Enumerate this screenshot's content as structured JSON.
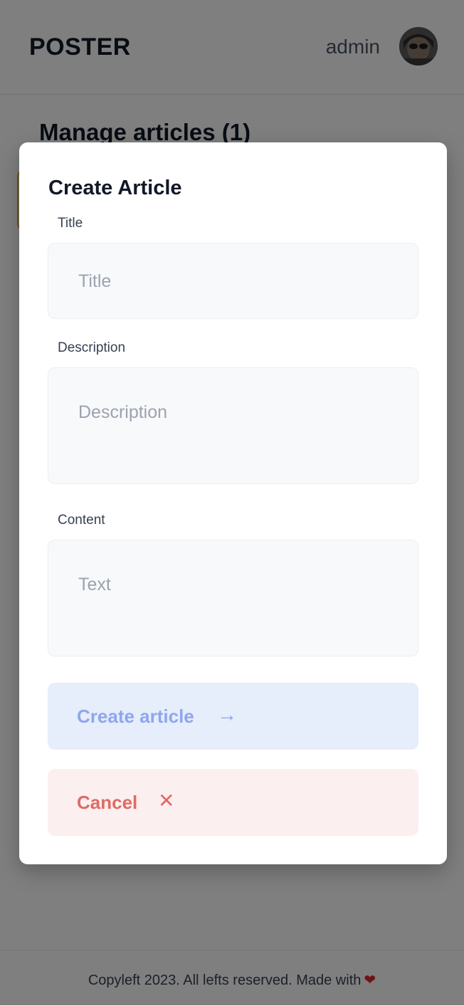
{
  "header": {
    "logo": "POSTER",
    "username": "admin"
  },
  "main": {
    "title": "Manage articles (1)"
  },
  "modal": {
    "title": "Create Article",
    "fields": {
      "title": {
        "label": "Title",
        "placeholder": "Title"
      },
      "description": {
        "label": "Description",
        "placeholder": "Description"
      },
      "content": {
        "label": "Content",
        "placeholder": "Text"
      }
    },
    "buttons": {
      "create_label": "Create article",
      "create_icon": "arrow-right-icon",
      "cancel_label": "Cancel",
      "cancel_icon": "close-icon"
    }
  },
  "footer": {
    "text": "Copyleft 2023. All lefts reserved. Made with",
    "icon": "heart-icon"
  },
  "colors": {
    "article_card_border": "#e8a321",
    "create_button_bg": "#e6edfb",
    "create_button_text": "#8ea7ec",
    "cancel_button_bg": "#fcefef",
    "cancel_button_text": "#e06a64",
    "overlay": "rgba(0,0,0,0.5)"
  }
}
